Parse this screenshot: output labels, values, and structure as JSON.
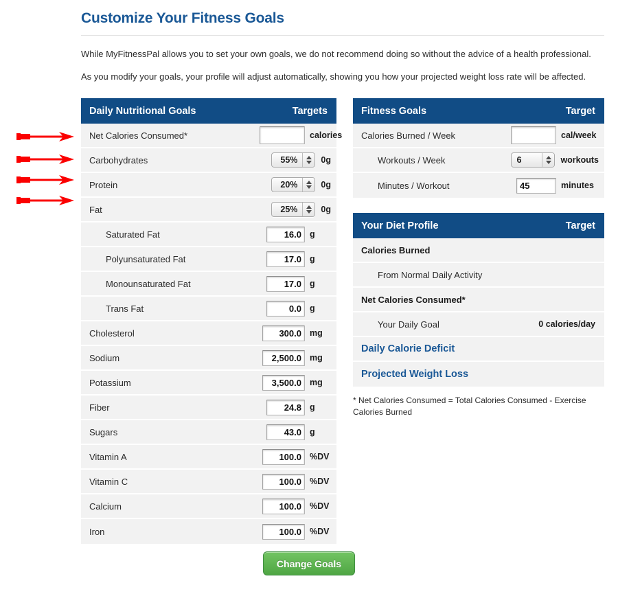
{
  "page": {
    "title": "Customize Your Fitness Goals",
    "intro_1": "While MyFitnessPal allows you to set your own goals, we do not recommend doing so without the advice of a health professional.",
    "intro_2": "As you modify your goals, your profile will adjust automatically, showing you how your projected weight loss rate will be affected.",
    "submit_label": "Change Goals",
    "accent_blue": "#1a5896",
    "header_blue": "#114c85",
    "button_green": "#4fa644",
    "annotation_red": "#fb0000"
  },
  "nutrition_panel": {
    "title": "Daily Nutritional Goals",
    "target_header": "Targets",
    "rows": [
      {
        "label": "Net Calories Consumed*",
        "control": "input",
        "value": "",
        "unit": "calories",
        "indent": false,
        "input_width": 66
      },
      {
        "label": "Carbohydrates",
        "control": "select",
        "value": "55%",
        "unit": "0g",
        "indent": false
      },
      {
        "label": "Protein",
        "control": "select",
        "value": "20%",
        "unit": "0g",
        "indent": false
      },
      {
        "label": "Fat",
        "control": "select",
        "value": "25%",
        "unit": "0g",
        "indent": false
      },
      {
        "label": "Saturated Fat",
        "control": "input",
        "value": "16.0",
        "unit": "g",
        "indent": true,
        "input_width": 56
      },
      {
        "label": "Polyunsaturated Fat",
        "control": "input",
        "value": "17.0",
        "unit": "g",
        "indent": true,
        "input_width": 56
      },
      {
        "label": "Monounsaturated Fat",
        "control": "input",
        "value": "17.0",
        "unit": "g",
        "indent": true,
        "input_width": 56
      },
      {
        "label": "Trans Fat",
        "control": "input",
        "value": "0.0",
        "unit": "g",
        "indent": true,
        "input_width": 56
      },
      {
        "label": "Cholesterol",
        "control": "input",
        "value": "300.0",
        "unit": "mg",
        "indent": false,
        "input_width": 62
      },
      {
        "label": "Sodium",
        "control": "input",
        "value": "2,500.0",
        "unit": "mg",
        "indent": false,
        "input_width": 62
      },
      {
        "label": "Potassium",
        "control": "input",
        "value": "3,500.0",
        "unit": "mg",
        "indent": false,
        "input_width": 62
      },
      {
        "label": "Fiber",
        "control": "input",
        "value": "24.8",
        "unit": "g",
        "indent": false,
        "input_width": 56
      },
      {
        "label": "Sugars",
        "control": "input",
        "value": "43.0",
        "unit": "g",
        "indent": false,
        "input_width": 56
      },
      {
        "label": "Vitamin A",
        "control": "input",
        "value": "100.0",
        "unit": "%DV",
        "indent": false,
        "input_width": 62
      },
      {
        "label": "Vitamin C",
        "control": "input",
        "value": "100.0",
        "unit": "%DV",
        "indent": false,
        "input_width": 62
      },
      {
        "label": "Calcium",
        "control": "input",
        "value": "100.0",
        "unit": "%DV",
        "indent": false,
        "input_width": 62
      },
      {
        "label": "Iron",
        "control": "input",
        "value": "100.0",
        "unit": "%DV",
        "indent": false,
        "input_width": 62
      }
    ]
  },
  "fitness_panel": {
    "title": "Fitness Goals",
    "target_header": "Target",
    "rows": [
      {
        "label": "Calories Burned / Week",
        "control": "input",
        "value": "",
        "unit": "cal/week",
        "indent": false,
        "input_width": 66
      },
      {
        "label": "Workouts / Week",
        "control": "select",
        "value": "6",
        "unit": "workouts",
        "indent": true
      },
      {
        "label": "Minutes / Workout",
        "control": "input",
        "value": "45",
        "unit": "minutes",
        "indent": true,
        "input_width": 58
      }
    ]
  },
  "diet_profile_panel": {
    "title": "Your Diet Profile",
    "target_header": "Target",
    "rows": [
      {
        "label": "Calories Burned",
        "style": "bold",
        "value": ""
      },
      {
        "label": "From Normal Daily Activity",
        "style": "sub",
        "value": ""
      },
      {
        "label": "Net Calories Consumed*",
        "style": "bold",
        "value": ""
      },
      {
        "label": "Your Daily Goal",
        "style": "sub",
        "value": "0 calories/day"
      },
      {
        "label": "Daily Calorie Deficit",
        "style": "blue",
        "value": ""
      },
      {
        "label": "Projected Weight Loss",
        "style": "blue",
        "value": ""
      }
    ],
    "footnote": "* Net Calories Consumed = Total Calories Consumed - Exercise Calories Burned"
  },
  "annotations": {
    "arrow_count": 4,
    "arrow_tops": [
      190,
      223,
      253,
      283
    ],
    "targets": [
      "Net Calories Consumed*",
      "Carbohydrates",
      "Protein",
      "Fat"
    ]
  }
}
